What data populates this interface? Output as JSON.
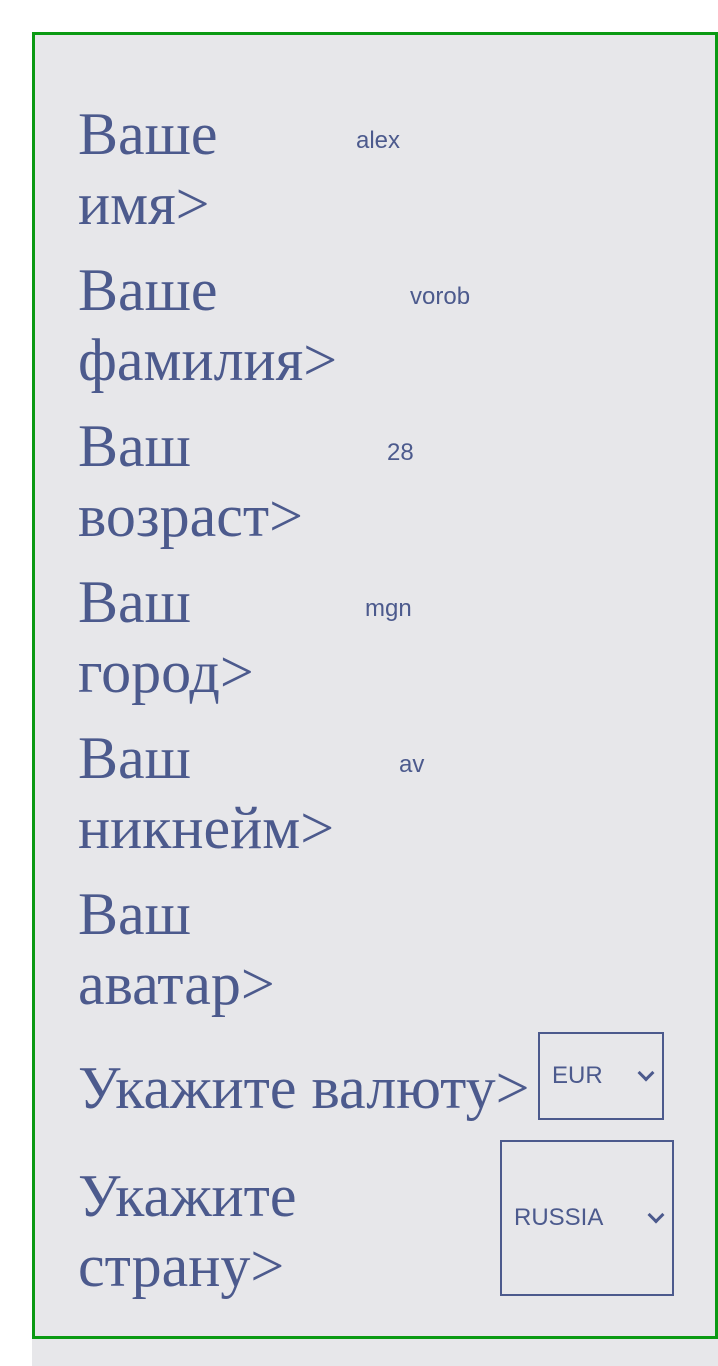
{
  "form": {
    "fields": [
      {
        "label": "Ваше\nимя>",
        "value": "alex"
      },
      {
        "label": "Ваше\nфамилия>",
        "value": "vorob"
      },
      {
        "label": "Ваш\nвозраст>",
        "value": "28"
      },
      {
        "label": "Ваш\nгород>",
        "value": "mgn"
      },
      {
        "label": "Ваш\nникнейм>",
        "value": "av"
      },
      {
        "label": "Ваш\nаватар>",
        "value": ""
      }
    ],
    "currency": {
      "label": "Укажите валюту>",
      "selected": "EUR"
    },
    "country": {
      "label": "Укажите\nстрану>",
      "selected": "RUSSIA"
    }
  },
  "colors": {
    "border": "#0b9a13",
    "text": "#4c5a8d",
    "background": "#e7e7ea"
  }
}
